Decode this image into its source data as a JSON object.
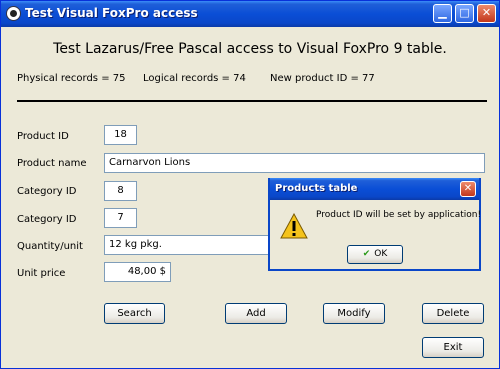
{
  "window": {
    "title": "Test Visual FoxPro access",
    "minimize_glyph": "▁",
    "maximize_glyph": "□",
    "close_glyph": "✕"
  },
  "heading": "Test Lazarus/Free Pascal access to Visual FoxPro 9 table.",
  "stats": {
    "physical": "Physical records = 75",
    "logical": "Logical records = 74",
    "new_id": "New product ID = 77"
  },
  "form": {
    "product_id_label": "Product ID",
    "product_id_value": "18",
    "product_name_label": "Product name",
    "product_name_value": "Carnarvon Lions",
    "category_id_label_1": "Category ID",
    "category_id_value_1": "8",
    "category_id_label_2": "Category ID",
    "category_id_value_2": "7",
    "quantity_label": "Quantity/unit",
    "quantity_value": "12 kg pkg.",
    "unit_price_label": "Unit price",
    "unit_price_value": "48,00 $"
  },
  "buttons": {
    "search": "Search",
    "add": "Add",
    "modify": "Modify",
    "delete": "Delete",
    "exit": "Exit"
  },
  "dialog": {
    "title": "Products table",
    "message": "Product ID will be set by application!",
    "ok": "OK",
    "close_glyph": "✕",
    "icon": "warning-icon"
  }
}
